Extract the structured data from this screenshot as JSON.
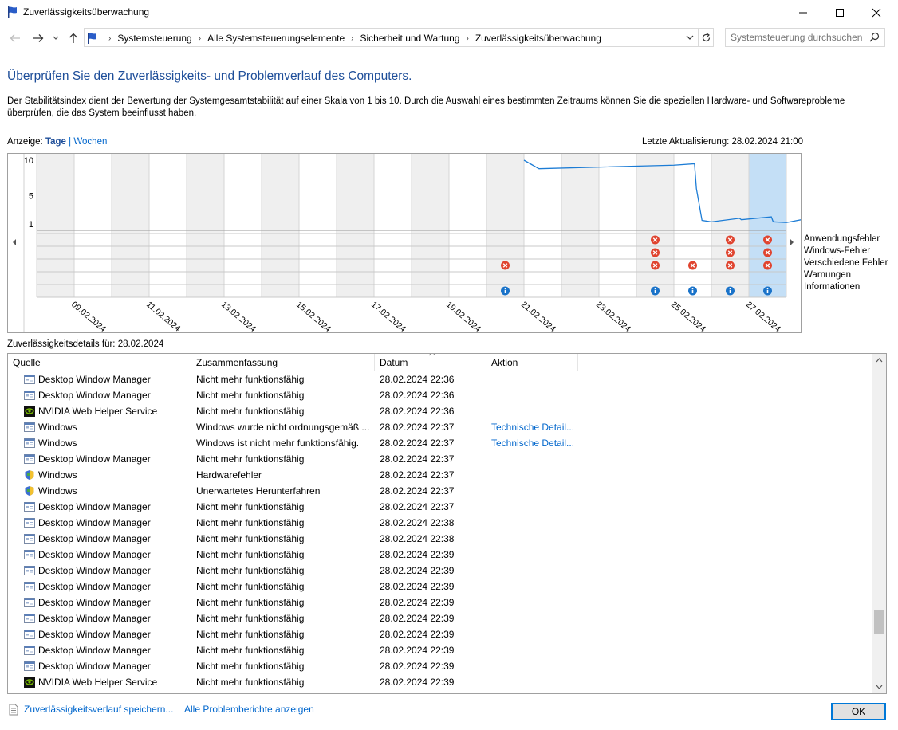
{
  "window": {
    "title": "Zuverlässigkeitsüberwachung",
    "minimize_icon": "minimize-icon",
    "maximize_icon": "maximize-icon",
    "close_icon": "close-icon"
  },
  "address": {
    "crumbs": [
      "Systemsteuerung",
      "Alle Systemsteuerungselemente",
      "Sicherheit und Wartung",
      "Zuverlässigkeitsüberwachung"
    ],
    "search_placeholder": "Systemsteuerung durchsuchen"
  },
  "page": {
    "heading": "Überprüfen Sie den Zuverlässigkeits- und Problemverlauf des Computers.",
    "description": "Der Stabilitätsindex dient der Bewertung der Systemgesamtstabilität auf einer Skala von 1 bis 10. Durch die Auswahl eines bestimmten Zeitraums können Sie die speziellen Hardware- und Softwareprobleme überprüfen, die das System beeinflusst haben.",
    "view_label": "Anzeige:",
    "view_days": "Tage",
    "view_separator": "|",
    "view_weeks": "Wochen",
    "last_update": "Letzte Aktualisierung: 28.02.2024 21:00",
    "details_label": "Zuverlässigkeitsdetails für: 28.02.2024"
  },
  "chart_data": {
    "type": "line",
    "y_ticks": [
      "10",
      "5",
      "1"
    ],
    "ylim": [
      1,
      10
    ],
    "date_labels": [
      "09.02.2024",
      "11.02.2024",
      "13.02.2024",
      "15.02.2024",
      "17.02.2024",
      "19.02.2024",
      "21.02.2024",
      "23.02.2024",
      "25.02.2024",
      "27.02.2024"
    ],
    "columns": 20,
    "first_column_date": "08.02.2024",
    "selected_column_date": "28.02.2024",
    "stability_series": [
      {
        "x": 13.0,
        "y": 10
      },
      {
        "x": 13.4,
        "y": 8.8
      },
      {
        "x": 17.0,
        "y": 9.3
      },
      {
        "x": 17.55,
        "y": 9.5
      },
      {
        "x": 17.6,
        "y": 6.0
      },
      {
        "x": 17.75,
        "y": 1.5
      },
      {
        "x": 18.0,
        "y": 1.3
      },
      {
        "x": 18.75,
        "y": 1.8
      },
      {
        "x": 18.8,
        "y": 1.6
      },
      {
        "x": 19.6,
        "y": 2.0
      },
      {
        "x": 19.65,
        "y": 1.3
      },
      {
        "x": 20.0,
        "y": 1.2
      },
      {
        "x": 20.7,
        "y": 1.9
      },
      {
        "x": 20.9,
        "y": 1.1
      },
      {
        "x": 21.0,
        "y": 1.1
      }
    ],
    "legend": [
      "Anwendungsfehler",
      "Windows-Fehler",
      "Verschiedene Fehler",
      "Warnungen",
      "Informationen"
    ],
    "events": [
      {
        "row": 0,
        "cols": [
          16,
          18,
          19
        ],
        "kind": "error"
      },
      {
        "row": 1,
        "cols": [
          16,
          18,
          19
        ],
        "kind": "error"
      },
      {
        "row": 2,
        "cols": [
          12,
          16,
          17,
          18,
          19
        ],
        "kind": "error"
      },
      {
        "row": 4,
        "cols": [
          12,
          16,
          17,
          18,
          19
        ],
        "kind": "info"
      }
    ]
  },
  "table": {
    "headers": [
      "Quelle",
      "Zusammenfassung",
      "Datum",
      "Aktion"
    ],
    "rows": [
      {
        "icon": "app-window-icon",
        "source": "Desktop Window Manager",
        "summary": "Nicht mehr funktionsfähig",
        "date": "28.02.2024 22:36",
        "action": ""
      },
      {
        "icon": "app-window-icon",
        "source": "Desktop Window Manager",
        "summary": "Nicht mehr funktionsfähig",
        "date": "28.02.2024 22:36",
        "action": ""
      },
      {
        "icon": "nvidia-icon",
        "source": "NVIDIA Web Helper Service",
        "summary": "Nicht mehr funktionsfähig",
        "date": "28.02.2024 22:36",
        "action": ""
      },
      {
        "icon": "app-window-icon",
        "source": "Windows",
        "summary": "Windows wurde nicht ordnungsgemäß ...",
        "date": "28.02.2024 22:37",
        "action": "Technische Detail..."
      },
      {
        "icon": "app-window-icon",
        "source": "Windows",
        "summary": "Windows ist nicht mehr funktionsfähig.",
        "date": "28.02.2024 22:37",
        "action": "Technische Detail..."
      },
      {
        "icon": "app-window-icon",
        "source": "Desktop Window Manager",
        "summary": "Nicht mehr funktionsfähig",
        "date": "28.02.2024 22:37",
        "action": ""
      },
      {
        "icon": "security-shield-icon",
        "source": "Windows",
        "summary": "Hardwarefehler",
        "date": "28.02.2024 22:37",
        "action": ""
      },
      {
        "icon": "security-shield-icon",
        "source": "Windows",
        "summary": "Unerwartetes Herunterfahren",
        "date": "28.02.2024 22:37",
        "action": ""
      },
      {
        "icon": "app-window-icon",
        "source": "Desktop Window Manager",
        "summary": "Nicht mehr funktionsfähig",
        "date": "28.02.2024 22:37",
        "action": ""
      },
      {
        "icon": "app-window-icon",
        "source": "Desktop Window Manager",
        "summary": "Nicht mehr funktionsfähig",
        "date": "28.02.2024 22:38",
        "action": ""
      },
      {
        "icon": "app-window-icon",
        "source": "Desktop Window Manager",
        "summary": "Nicht mehr funktionsfähig",
        "date": "28.02.2024 22:38",
        "action": ""
      },
      {
        "icon": "app-window-icon",
        "source": "Desktop Window Manager",
        "summary": "Nicht mehr funktionsfähig",
        "date": "28.02.2024 22:39",
        "action": ""
      },
      {
        "icon": "app-window-icon",
        "source": "Desktop Window Manager",
        "summary": "Nicht mehr funktionsfähig",
        "date": "28.02.2024 22:39",
        "action": ""
      },
      {
        "icon": "app-window-icon",
        "source": "Desktop Window Manager",
        "summary": "Nicht mehr funktionsfähig",
        "date": "28.02.2024 22:39",
        "action": ""
      },
      {
        "icon": "app-window-icon",
        "source": "Desktop Window Manager",
        "summary": "Nicht mehr funktionsfähig",
        "date": "28.02.2024 22:39",
        "action": ""
      },
      {
        "icon": "app-window-icon",
        "source": "Desktop Window Manager",
        "summary": "Nicht mehr funktionsfähig",
        "date": "28.02.2024 22:39",
        "action": ""
      },
      {
        "icon": "app-window-icon",
        "source": "Desktop Window Manager",
        "summary": "Nicht mehr funktionsfähig",
        "date": "28.02.2024 22:39",
        "action": ""
      },
      {
        "icon": "app-window-icon",
        "source": "Desktop Window Manager",
        "summary": "Nicht mehr funktionsfähig",
        "date": "28.02.2024 22:39",
        "action": ""
      },
      {
        "icon": "app-window-icon",
        "source": "Desktop Window Manager",
        "summary": "Nicht mehr funktionsfähig",
        "date": "28.02.2024 22:39",
        "action": ""
      },
      {
        "icon": "nvidia-icon",
        "source": "NVIDIA Web Helper Service",
        "summary": "Nicht mehr funktionsfähig",
        "date": "28.02.2024 22:39",
        "action": ""
      }
    ]
  },
  "footer": {
    "save_link": "Zuverlässigkeitsverlauf speichern...",
    "all_reports_link": "Alle Problemberichte anzeigen",
    "ok_label": "OK"
  },
  "colors": {
    "heading": "#1e4e99",
    "link": "#0066cc",
    "line": "#1c7cd5",
    "selected_column": "#c4dff6",
    "shaded_column": "#efefef",
    "error": "#e0442f",
    "info": "#1a73c9"
  }
}
